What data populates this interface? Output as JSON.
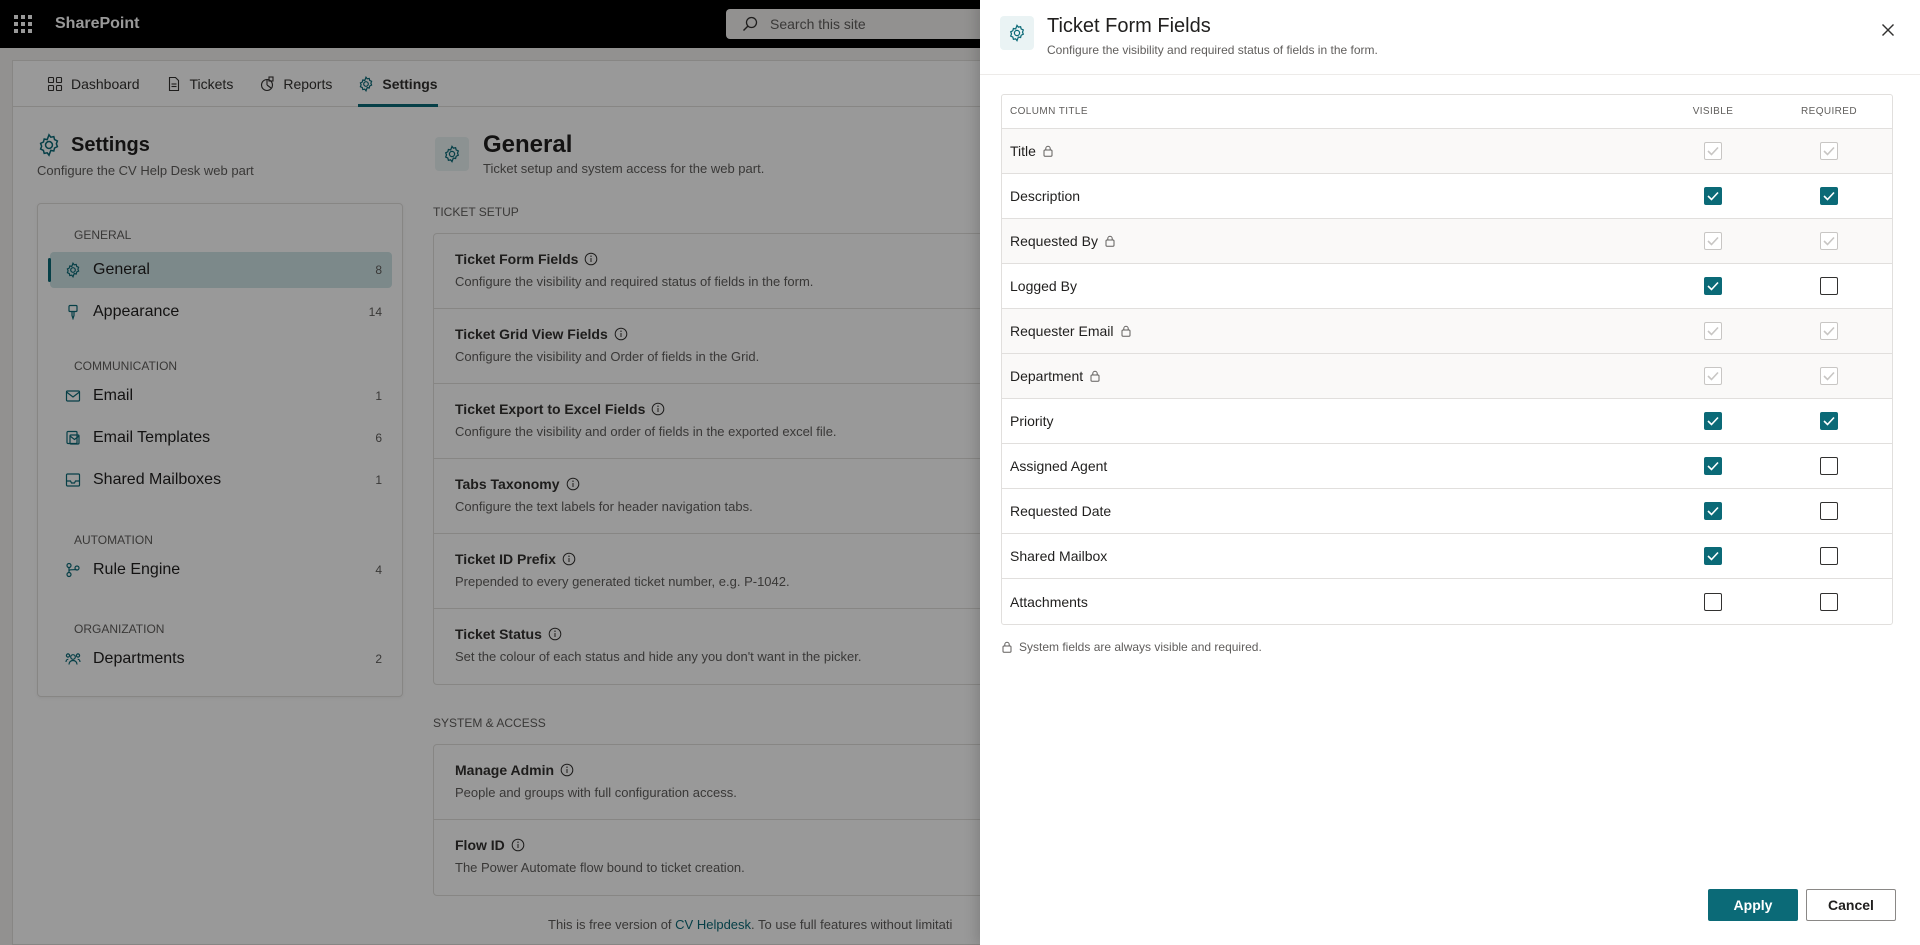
{
  "suite": {
    "app_name": "SharePoint",
    "search_placeholder": "Search this site"
  },
  "nav": {
    "tabs": [
      {
        "label": "Dashboard",
        "icon": "grid-icon"
      },
      {
        "label": "Tickets",
        "icon": "document-icon"
      },
      {
        "label": "Reports",
        "icon": "reports-icon"
      },
      {
        "label": "Settings",
        "icon": "gear-icon",
        "active": true
      }
    ]
  },
  "settings": {
    "title": "Settings",
    "subtitle": "Configure the CV Help Desk web part"
  },
  "sidebar": {
    "groups": [
      {
        "label": "GENERAL",
        "items": [
          {
            "label": "General",
            "count": "8",
            "icon": "gear-icon",
            "active": true
          },
          {
            "label": "Appearance",
            "count": "14",
            "icon": "brush-icon"
          }
        ]
      },
      {
        "label": "COMMUNICATION",
        "items": [
          {
            "label": "Email",
            "count": "1",
            "icon": "mail-icon"
          },
          {
            "label": "Email Templates",
            "count": "6",
            "icon": "template-icon"
          },
          {
            "label": "Shared Mailboxes",
            "count": "1",
            "icon": "inbox-icon"
          }
        ]
      },
      {
        "label": "AUTOMATION",
        "items": [
          {
            "label": "Rule Engine",
            "count": "4",
            "icon": "flow-icon"
          }
        ]
      },
      {
        "label": "ORGANIZATION",
        "items": [
          {
            "label": "Departments",
            "count": "2",
            "icon": "people-icon"
          }
        ]
      }
    ]
  },
  "general": {
    "title": "General",
    "subtitle": "Ticket setup and system access for the web part.",
    "ticket_setup_label": "TICKET SETUP",
    "ticket_setup": [
      {
        "title": "Ticket Form Fields",
        "desc": "Configure the visibility and required status of fields in the form."
      },
      {
        "title": "Ticket Grid View Fields",
        "desc": "Configure the visibility and Order of fields in the Grid."
      },
      {
        "title": "Ticket Export to Excel Fields",
        "desc": "Configure the visibility and order of fields in the exported excel file."
      },
      {
        "title": "Tabs Taxonomy",
        "desc": "Configure the text labels for header navigation tabs."
      },
      {
        "title": "Ticket ID Prefix",
        "desc": "Prepended to every generated ticket number, e.g. P-1042."
      },
      {
        "title": "Ticket Status",
        "desc": "Set the colour of each status and hide any you don't want in the picker."
      }
    ],
    "system_label": "SYSTEM & ACCESS",
    "system": [
      {
        "title": "Manage Admin",
        "desc": "People and groups with full configuration access."
      },
      {
        "title": "Flow ID",
        "desc": "The Power Automate flow bound to ticket creation."
      }
    ],
    "footer_prefix": "This is free version of ",
    "footer_link": "CV Helpdesk",
    "footer_suffix": ". To use full features without limitati"
  },
  "panel": {
    "title": "Ticket Form Fields",
    "subtitle": "Configure the visibility and required status of fields in the form.",
    "columns": {
      "title": "COLUMN TITLE",
      "visible": "VISIBLE",
      "required": "REQUIRED"
    },
    "fields": [
      {
        "name": "Title",
        "locked": true,
        "visible": true,
        "required": true
      },
      {
        "name": "Description",
        "locked": false,
        "visible": true,
        "required": true
      },
      {
        "name": "Requested By",
        "locked": true,
        "visible": true,
        "required": true
      },
      {
        "name": "Logged By",
        "locked": false,
        "visible": true,
        "required": false
      },
      {
        "name": "Requester Email",
        "locked": true,
        "visible": true,
        "required": true
      },
      {
        "name": "Department",
        "locked": true,
        "visible": true,
        "required": true
      },
      {
        "name": "Priority",
        "locked": false,
        "visible": true,
        "required": true
      },
      {
        "name": "Assigned Agent",
        "locked": false,
        "visible": true,
        "required": false
      },
      {
        "name": "Requested Date",
        "locked": false,
        "visible": true,
        "required": false
      },
      {
        "name": "Shared Mailbox",
        "locked": false,
        "visible": true,
        "required": false
      },
      {
        "name": "Attachments",
        "locked": false,
        "visible": false,
        "required": false
      }
    ],
    "system_note": "System fields are always visible and required.",
    "apply_label": "Apply",
    "cancel_label": "Cancel"
  },
  "colors": {
    "accent": "#0b6a77",
    "accent_light": "#cfe4e7",
    "suitebar": "#000000"
  }
}
